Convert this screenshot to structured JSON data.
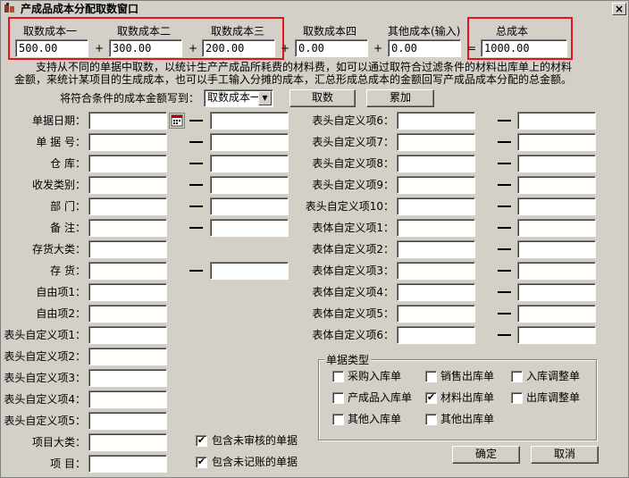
{
  "window": {
    "title": "产成品成本分配取数窗口",
    "close_label": "×"
  },
  "costs": [
    {
      "label": "取数成本一",
      "value": "500.00"
    },
    {
      "label": "取数成本二",
      "value": "300.00"
    },
    {
      "label": "取数成本三",
      "value": "200.00"
    },
    {
      "label": "取数成本四",
      "value": "0.00"
    },
    {
      "label": "其他成本(输入)",
      "value": "0.00"
    }
  ],
  "total": {
    "label": "总成本",
    "value": "1000.00"
  },
  "ops": {
    "plus": "+",
    "equals": "="
  },
  "description": "支持从不同的单据中取数，以统计生产产成品所耗费的材料费，如可以通过取符合过滤条件的材料出库单上的材料金额，来统计某项目的生成成本，也可以手工输入分摊的成本，汇总形成总成本的金额回写产成品成本分配的总金额。",
  "write_to": {
    "label": "将符合条件的成本金额写到：",
    "selected": "取数成本一"
  },
  "buttons": {
    "fetch": "取数",
    "accumulate": "累加",
    "ok": "确定",
    "cancel": "取消"
  },
  "left_fields": [
    "单据日期：",
    "单 据 号：",
    "仓    库：",
    "收发类别：",
    "部    门：",
    "备    注：",
    "存货大类：",
    "存    货：",
    "自由项1：",
    "自由项2：",
    "表头自定义项1：",
    "表头自定义项2：",
    "表头自定义项3：",
    "表头自定义项4：",
    "表头自定义项5：",
    "项目大类：",
    "项    目："
  ],
  "right_fields": [
    "表头自定义项6：",
    "表头自定义项7：",
    "表头自定义项8：",
    "表头自定义项9：",
    "表头自定义项10：",
    "表体自定义项1：",
    "表体自定义项2：",
    "表体自定义项3：",
    "表体自定义项4：",
    "表体自定义项5：",
    "表体自定义项6："
  ],
  "doc_types": {
    "title": "单据类型",
    "items": [
      {
        "label": "采购入库单",
        "checked": false
      },
      {
        "label": "销售出库单",
        "checked": false
      },
      {
        "label": "入库调整单",
        "checked": false
      },
      {
        "label": "产成品入库单",
        "checked": false
      },
      {
        "label": "材料出库单",
        "checked": true
      },
      {
        "label": "出库调整单",
        "checked": false
      },
      {
        "label": "其他入库单",
        "checked": false
      },
      {
        "label": "其他出库单",
        "checked": false
      }
    ]
  },
  "options": [
    {
      "label": "包含未审核的单据",
      "checked": true
    },
    {
      "label": "包含未记账的单据",
      "checked": true
    }
  ],
  "check_mark": "✔",
  "colors": {
    "highlight_red": "#e8121c",
    "window_bg": "#d4d0c8"
  }
}
